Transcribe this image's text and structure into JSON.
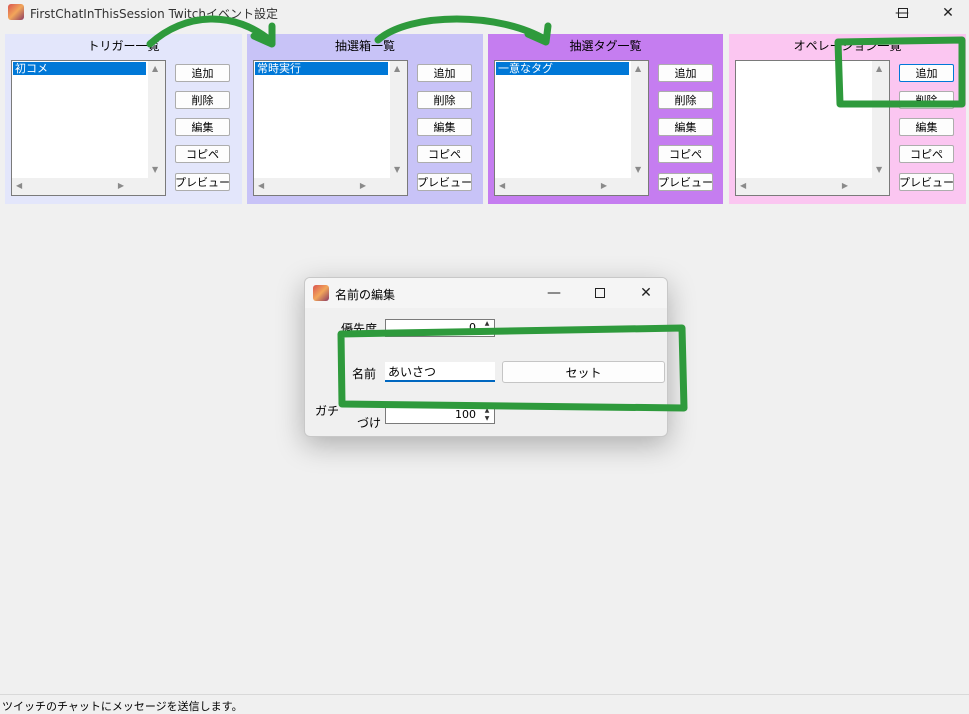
{
  "window": {
    "title": "FirstChatInThisSession Twitchイベント設定",
    "minimize_glyph": "—",
    "maximize_glyph": "☐",
    "close_glyph": "✕"
  },
  "panels": [
    {
      "title": "トリガー一覧",
      "bg": "#e3e6fb",
      "selected_item": "初コメ",
      "buttons": [
        "追加",
        "削除",
        "編集",
        "コピペ",
        "プレビュー"
      ]
    },
    {
      "title": "抽選箱一覧",
      "bg": "#c8c3f7",
      "selected_item": "常時実行",
      "buttons": [
        "追加",
        "削除",
        "編集",
        "コピペ",
        "プレビュー"
      ]
    },
    {
      "title": "抽選タグ一覧",
      "bg": "#c57df0",
      "selected_item": "一意なタグ",
      "buttons": [
        "追加",
        "削除",
        "編集",
        "コピペ",
        "プレビュー"
      ]
    },
    {
      "title": "オペレーション一覧",
      "bg": "#fbc6f1",
      "selected_item": "",
      "buttons": [
        "追加",
        "削除",
        "編集",
        "コピペ",
        "プレビュー"
      ]
    }
  ],
  "status_bar": {
    "text": "ツイッチのチャットにメッセージを送信します。"
  },
  "dialog": {
    "title": "名前の編集",
    "priority_label": "優先度",
    "priority_value": "0",
    "name_label": "名前",
    "name_value": "あいさつ",
    "set_button": "セット",
    "gacha_label": "ガチ",
    "gacha_label_cont": "づけ",
    "gacha_value": "100"
  },
  "colors": {
    "accent": "#0078d7",
    "annotation_green": "#2e9a3c"
  },
  "icons": [
    "app-icon",
    "minimize-icon",
    "maximize-icon",
    "close-icon",
    "scroll-up-arrow-icon",
    "scroll-down-arrow-icon",
    "scroll-left-arrow-icon",
    "scroll-right-arrow-icon"
  ]
}
